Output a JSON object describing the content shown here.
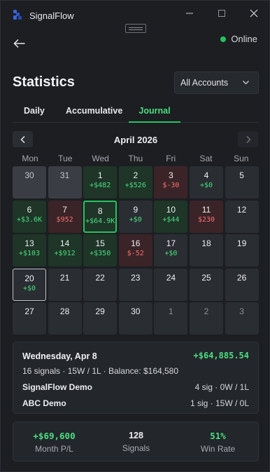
{
  "app": {
    "title": "SignalFlow"
  },
  "header": {
    "status": "Online",
    "page_title": "Statistics",
    "account_select": "All Accounts"
  },
  "tabs": [
    {
      "label": "Daily",
      "active": false
    },
    {
      "label": "Accumulative",
      "active": false
    },
    {
      "label": "Journal",
      "active": true
    }
  ],
  "calendar": {
    "month": "April 2026",
    "weekdays": [
      "Mon",
      "Tue",
      "Wed",
      "Thu",
      "Fri",
      "Sat",
      "Sun"
    ],
    "weeks": [
      [
        {
          "day": "30",
          "pnl": "",
          "state": "outside"
        },
        {
          "day": "31",
          "pnl": "",
          "state": "outside"
        },
        {
          "day": "1",
          "pnl": "+$482",
          "state": "win"
        },
        {
          "day": "2",
          "pnl": "+$526",
          "state": "win"
        },
        {
          "day": "3",
          "pnl": "$-30",
          "state": "loss"
        },
        {
          "day": "4",
          "pnl": "+$0",
          "state": "normal"
        },
        {
          "day": "5",
          "pnl": "",
          "state": "normal"
        }
      ],
      [
        {
          "day": "6",
          "pnl": "+$3.6K",
          "state": "win"
        },
        {
          "day": "7",
          "pnl": "$952",
          "state": "loss"
        },
        {
          "day": "8",
          "pnl": "+$64.9K",
          "state": "win-selected"
        },
        {
          "day": "9",
          "pnl": "+$0",
          "state": "normal"
        },
        {
          "day": "10",
          "pnl": "+$44",
          "state": "win"
        },
        {
          "day": "11",
          "pnl": "$230",
          "state": "loss"
        },
        {
          "day": "12",
          "pnl": "",
          "state": "normal"
        }
      ],
      [
        {
          "day": "13",
          "pnl": "+$103",
          "state": "win"
        },
        {
          "day": "14",
          "pnl": "+$912",
          "state": "win"
        },
        {
          "day": "15",
          "pnl": "+$350",
          "state": "win"
        },
        {
          "day": "16",
          "pnl": "$-52",
          "state": "loss"
        },
        {
          "day": "17",
          "pnl": "+$0",
          "state": "normal"
        },
        {
          "day": "18",
          "pnl": "",
          "state": "normal"
        },
        {
          "day": "19",
          "pnl": "",
          "state": "normal"
        }
      ],
      [
        {
          "day": "20",
          "pnl": "+$0",
          "state": "today"
        },
        {
          "day": "21",
          "pnl": "",
          "state": "normal"
        },
        {
          "day": "22",
          "pnl": "",
          "state": "normal"
        },
        {
          "day": "23",
          "pnl": "",
          "state": "normal"
        },
        {
          "day": "24",
          "pnl": "",
          "state": "normal"
        },
        {
          "day": "25",
          "pnl": "",
          "state": "normal"
        },
        {
          "day": "26",
          "pnl": "",
          "state": "normal"
        }
      ],
      [
        {
          "day": "27",
          "pnl": "",
          "state": "normal"
        },
        {
          "day": "28",
          "pnl": "",
          "state": "normal"
        },
        {
          "day": "29",
          "pnl": "",
          "state": "normal"
        },
        {
          "day": "30",
          "pnl": "",
          "state": "normal"
        },
        {
          "day": "1",
          "pnl": "",
          "state": "outside-next"
        },
        {
          "day": "2",
          "pnl": "",
          "state": "outside-next"
        },
        {
          "day": "3",
          "pnl": "",
          "state": "outside-next"
        }
      ]
    ]
  },
  "detail": {
    "date": "Wednesday, Apr 8",
    "total": "+$64,885.54",
    "summary": "16 signals · 15W / 1L · Balance: $164,580",
    "accounts": [
      {
        "name": "SignalFlow Demo",
        "stats": "4 sig · 0W / 1L"
      },
      {
        "name": "ABC Demo",
        "stats": "1 sig · 15W / 0L"
      }
    ]
  },
  "stats": {
    "month_pl": {
      "value": "+$69,600",
      "label": "Month P/L"
    },
    "signals": {
      "value": "128",
      "label": "Signals"
    },
    "win_rate": {
      "value": "51%",
      "label": "Win Rate"
    }
  },
  "colors": {
    "accent": "#22c55e",
    "positive": "#4ade80",
    "negative": "#f87171",
    "background": "#1c1e22"
  },
  "icons": {
    "logo": "signalflow-logo-icon",
    "back": "arrow-left-icon",
    "prev": "chevron-left-icon",
    "next": "chevron-right-icon",
    "dropdown": "chevron-down-icon"
  }
}
